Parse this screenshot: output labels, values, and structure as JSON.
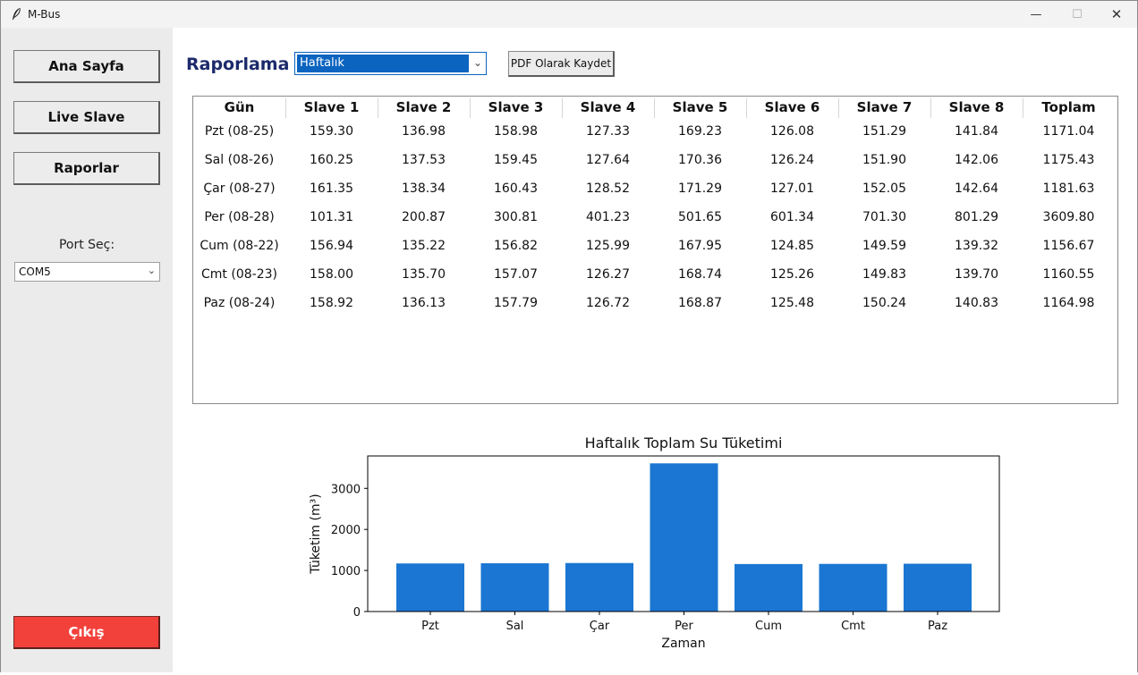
{
  "window": {
    "title": "M-Bus",
    "minimize_glyph": "—",
    "maximize_glyph": "☐",
    "close_glyph": "✕"
  },
  "sidebar": {
    "buttons": [
      {
        "label": "Ana Sayfa"
      },
      {
        "label": "Live Slave"
      },
      {
        "label": "Raporlar"
      }
    ],
    "port_label": "Port Seç:",
    "port_value": "COM5",
    "exit_label": "Çıkış"
  },
  "main": {
    "title": "Raporlama",
    "report_period": "Haftalık",
    "pdf_button": "PDF Olarak Kaydet"
  },
  "table": {
    "headers": [
      "Gün",
      "Slave 1",
      "Slave 2",
      "Slave 3",
      "Slave 4",
      "Slave 5",
      "Slave 6",
      "Slave 7",
      "Slave 8",
      "Toplam"
    ],
    "rows": [
      [
        "Pzt (08-25)",
        "159.30",
        "136.98",
        "158.98",
        "127.33",
        "169.23",
        "126.08",
        "151.29",
        "141.84",
        "1171.04"
      ],
      [
        "Sal (08-26)",
        "160.25",
        "137.53",
        "159.45",
        "127.64",
        "170.36",
        "126.24",
        "151.90",
        "142.06",
        "1175.43"
      ],
      [
        "Çar (08-27)",
        "161.35",
        "138.34",
        "160.43",
        "128.52",
        "171.29",
        "127.01",
        "152.05",
        "142.64",
        "1181.63"
      ],
      [
        "Per (08-28)",
        "101.31",
        "200.87",
        "300.81",
        "401.23",
        "501.65",
        "601.34",
        "701.30",
        "801.29",
        "3609.80"
      ],
      [
        "Cum (08-22)",
        "156.94",
        "135.22",
        "156.82",
        "125.99",
        "167.95",
        "124.85",
        "149.59",
        "139.32",
        "1156.67"
      ],
      [
        "Cmt (08-23)",
        "158.00",
        "135.70",
        "157.07",
        "126.27",
        "168.74",
        "125.26",
        "149.83",
        "139.70",
        "1160.55"
      ],
      [
        "Paz (08-24)",
        "158.92",
        "136.13",
        "157.79",
        "126.72",
        "168.87",
        "125.48",
        "150.24",
        "140.83",
        "1164.98"
      ]
    ]
  },
  "chart_data": {
    "type": "bar",
    "title": "Haftalık Toplam Su Tüketimi",
    "xlabel": "Zaman",
    "ylabel": "Tüketim (m³)",
    "categories": [
      "Pzt",
      "Sal",
      "Çar",
      "Per",
      "Cum",
      "Cmt",
      "Paz"
    ],
    "values": [
      1171.04,
      1175.43,
      1181.63,
      3609.8,
      1156.67,
      1160.55,
      1164.98
    ],
    "ylim": [
      0,
      3790
    ],
    "yticks": [
      0,
      1000,
      2000,
      3000
    ],
    "bar_color": "#1a76d2",
    "grid": false
  }
}
